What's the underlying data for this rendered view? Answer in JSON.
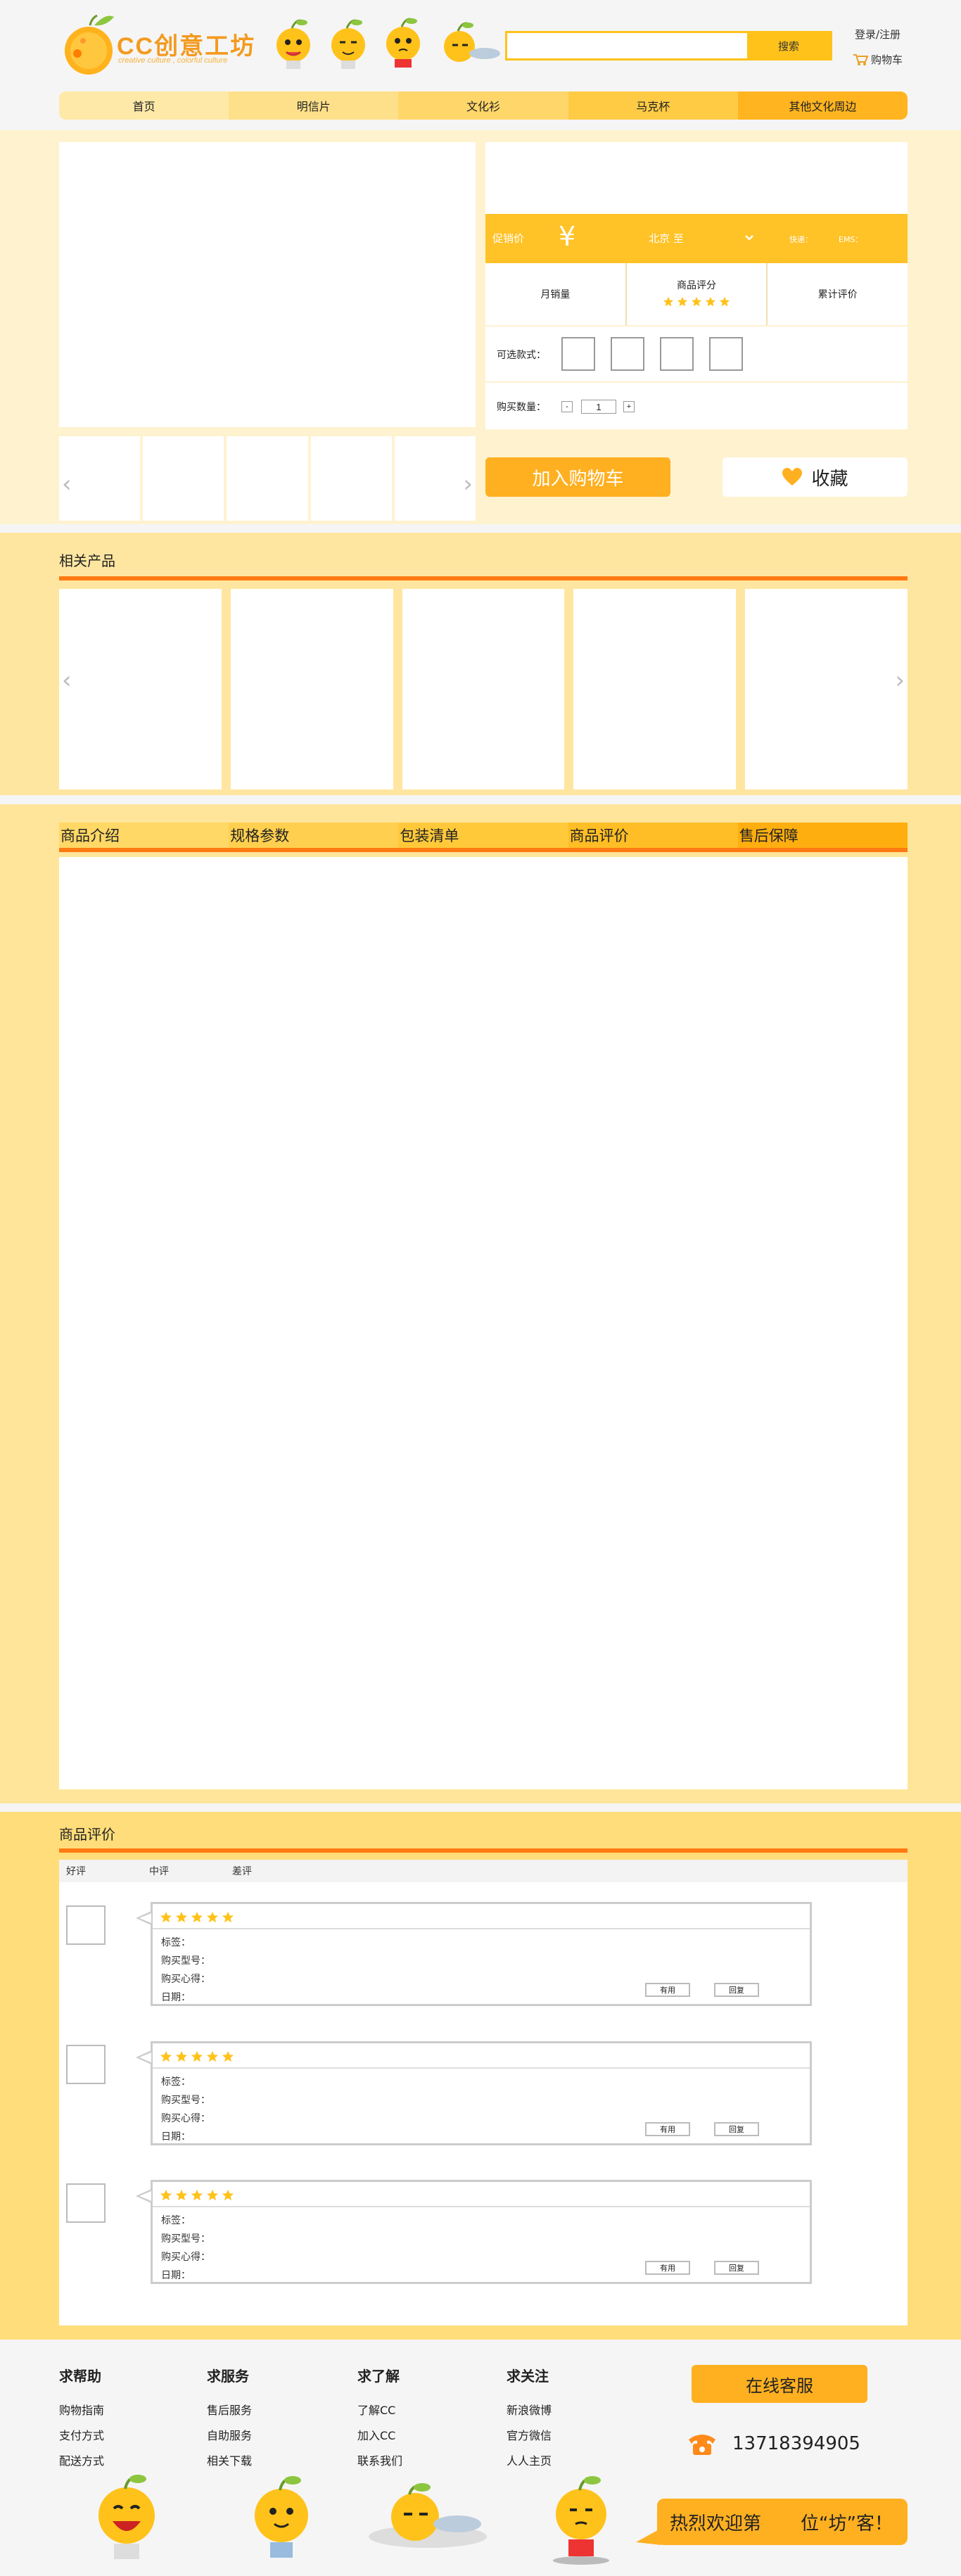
{
  "header": {
    "logo_text": "CC创意工坊",
    "logo_sub": "creative culture , colorful culture",
    "search_placeholder": "",
    "search_button": "搜索",
    "login": "登录/注册",
    "cart": "购物车"
  },
  "nav": {
    "items": [
      {
        "label": "首页",
        "color": "#ffe9a8"
      },
      {
        "label": "明信片",
        "color": "#ffe08a"
      },
      {
        "label": "文化衫",
        "color": "#ffd66a"
      },
      {
        "label": "马克杯",
        "color": "#ffcb45"
      },
      {
        "label": "其他文化周边",
        "color": "#ffb420"
      }
    ]
  },
  "product": {
    "price_label": "促销价",
    "price_symbol": "¥",
    "ship_from": "北京 至",
    "ship_label": "快递：",
    "ems_label": "EMS：",
    "monthly_sales": "月销量",
    "rating_label": "商品评分",
    "rating": 5,
    "reviews_total": "累计评价",
    "styles_label": "可选款式：",
    "qty_label": "购买数量：",
    "qty_value": "1",
    "qty_minus": "-",
    "qty_plus": "+",
    "add_cart": "加入购物车",
    "favorite": "收藏",
    "thumb_prev": "‹",
    "thumb_next": "›"
  },
  "related": {
    "title": "相关产品",
    "prev": "‹",
    "next": "›"
  },
  "detail": {
    "tabs": [
      {
        "label": "商品介绍",
        "color": "#ffd866"
      },
      {
        "label": "规格参数",
        "color": "#ffd04f"
      },
      {
        "label": "包装清单",
        "color": "#ffc93a"
      },
      {
        "label": "商品评价",
        "color": "#ffbe25"
      },
      {
        "label": "售后保障",
        "color": "#ffae10"
      }
    ]
  },
  "reviews": {
    "title": "商品评价",
    "tabs": [
      "好评",
      "中评",
      "差评"
    ],
    "items": [
      {
        "stars": 5,
        "tag": "标签：",
        "model": "购买型号：",
        "feeling": "购买心得：",
        "date": "日期：",
        "useful": "有用",
        "reply": "回复"
      },
      {
        "stars": 5,
        "tag": "标签：",
        "model": "购买型号：",
        "feeling": "购买心得：",
        "date": "日期：",
        "useful": "有用",
        "reply": "回复"
      },
      {
        "stars": 5,
        "tag": "标签：",
        "model": "购买型号：",
        "feeling": "购买心得：",
        "date": "日期：",
        "useful": "有用",
        "reply": "回复"
      }
    ]
  },
  "footer": {
    "cols": [
      {
        "title": "求帮助",
        "items": [
          "购物指南",
          "支付方式",
          "配送方式"
        ]
      },
      {
        "title": "求服务",
        "items": [
          "售后服务",
          "自助服务",
          "相关下载"
        ]
      },
      {
        "title": "求了解",
        "items": [
          "了解CC",
          "加入CC",
          "联系我们"
        ]
      },
      {
        "title": "求关注",
        "items": [
          "新浪微博",
          "官方微信",
          "人人主页"
        ]
      }
    ],
    "online_service": "在线客服",
    "phone": "13718394905",
    "welcome_a": "热烈欢迎第",
    "welcome_b": "位“坊”客！"
  },
  "colors": {
    "accent": "#ffc21a",
    "orange_line": "#ff7a12",
    "star": "#ffc21a"
  }
}
